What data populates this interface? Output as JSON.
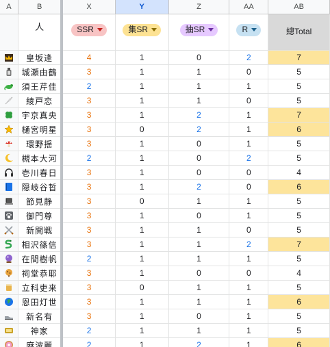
{
  "columns": {
    "a": "A",
    "b": "B",
    "x": "X",
    "y": "Y",
    "z": "Z",
    "aa": "AA",
    "ab": "AB"
  },
  "header": {
    "person_label": "人",
    "ssr": "SSR",
    "ji_sr": "集SR",
    "chou_sr": "抽SR",
    "r": "R",
    "total": "總Total"
  },
  "rows": [
    {
      "icon": "crown-icon",
      "name": "皇坂逢",
      "x": "4",
      "y": "1",
      "z": "0",
      "aa": "2",
      "total": "7",
      "hl": true,
      "xc": "orange",
      "zc": "black",
      "aac": "blue"
    },
    {
      "icon": "bottle-icon",
      "name": "城瀬由鶴",
      "x": "3",
      "y": "1",
      "z": "1",
      "aa": "0",
      "total": "5",
      "hl": false,
      "xc": "orange",
      "zc": "black",
      "aac": "black"
    },
    {
      "icon": "lizard-icon",
      "name": "須王芹佳",
      "x": "2",
      "y": "1",
      "z": "1",
      "aa": "1",
      "total": "5",
      "hl": false,
      "xc": "blue",
      "zc": "black",
      "aac": "black"
    },
    {
      "icon": "feather-icon",
      "name": "綾戸恋",
      "x": "3",
      "y": "1",
      "z": "1",
      "aa": "0",
      "total": "5",
      "hl": false,
      "xc": "orange",
      "zc": "black",
      "aac": "black"
    },
    {
      "icon": "clover-icon",
      "name": "宇京真央",
      "x": "3",
      "y": "1",
      "z": "2",
      "aa": "1",
      "total": "7",
      "hl": true,
      "xc": "orange",
      "zc": "blue",
      "aac": "black"
    },
    {
      "icon": "star-icon",
      "name": "樋宮明星",
      "x": "3",
      "y": "0",
      "z": "2",
      "aa": "1",
      "total": "6",
      "hl": true,
      "xc": "orange",
      "zc": "blue",
      "aac": "black"
    },
    {
      "icon": "mushroom-icon",
      "name": "環野揺",
      "x": "3",
      "y": "1",
      "z": "0",
      "aa": "1",
      "total": "5",
      "hl": false,
      "xc": "orange",
      "zc": "black",
      "aac": "black"
    },
    {
      "icon": "moon-icon",
      "name": "槻本大河",
      "x": "2",
      "y": "1",
      "z": "0",
      "aa": "2",
      "total": "5",
      "hl": false,
      "xc": "blue",
      "zc": "black",
      "aac": "blue"
    },
    {
      "icon": "headphones-icon",
      "name": "壱川春日",
      "x": "3",
      "y": "1",
      "z": "0",
      "aa": "0",
      "total": "4",
      "hl": false,
      "xc": "orange",
      "zc": "black",
      "aac": "black"
    },
    {
      "icon": "book-icon",
      "name": "隠岐谷晢",
      "x": "3",
      "y": "1",
      "z": "2",
      "aa": "0",
      "total": "6",
      "hl": true,
      "xc": "orange",
      "zc": "blue",
      "aac": "black"
    },
    {
      "icon": "laptop-icon",
      "name": "節見静",
      "x": "3",
      "y": "0",
      "z": "1",
      "aa": "1",
      "total": "5",
      "hl": false,
      "xc": "orange",
      "zc": "black",
      "aac": "black"
    },
    {
      "icon": "pawprint-icon",
      "name": "御門尊",
      "x": "3",
      "y": "1",
      "z": "0",
      "aa": "1",
      "total": "5",
      "hl": false,
      "xc": "orange",
      "zc": "black",
      "aac": "black"
    },
    {
      "icon": "swords-icon",
      "name": "新開戦",
      "x": "3",
      "y": "1",
      "z": "1",
      "aa": "0",
      "total": "5",
      "hl": false,
      "xc": "orange",
      "zc": "black",
      "aac": "black"
    },
    {
      "icon": "snake-icon",
      "name": "相沢篠信",
      "x": "3",
      "y": "1",
      "z": "1",
      "aa": "2",
      "total": "7",
      "hl": true,
      "xc": "orange",
      "zc": "black",
      "aac": "blue"
    },
    {
      "icon": "crystal-ball-icon",
      "name": "在間樹帆",
      "x": "2",
      "y": "1",
      "z": "1",
      "aa": "1",
      "total": "5",
      "hl": false,
      "xc": "blue",
      "zc": "black",
      "aac": "black"
    },
    {
      "icon": "cookie-icon",
      "name": "祠堂恭耶",
      "x": "3",
      "y": "1",
      "z": "0",
      "aa": "0",
      "total": "4",
      "hl": false,
      "xc": "orange",
      "zc": "black",
      "aac": "black"
    },
    {
      "icon": "cup-icon",
      "name": "立科吏来",
      "x": "3",
      "y": "0",
      "z": "1",
      "aa": "1",
      "total": "5",
      "hl": false,
      "xc": "orange",
      "zc": "black",
      "aac": "black"
    },
    {
      "icon": "globe-icon",
      "name": "恩田灯世",
      "x": "3",
      "y": "1",
      "z": "1",
      "aa": "1",
      "total": "6",
      "hl": true,
      "xc": "orange",
      "zc": "black",
      "aac": "black"
    },
    {
      "icon": "shoe-icon",
      "name": "新名有",
      "x": "3",
      "y": "1",
      "z": "0",
      "aa": "1",
      "total": "5",
      "hl": false,
      "xc": "orange",
      "zc": "black",
      "aac": "black"
    },
    {
      "icon": "badge-icon",
      "name": "神家",
      "x": "2",
      "y": "1",
      "z": "1",
      "aa": "1",
      "total": "5",
      "hl": false,
      "xc": "blue",
      "zc": "black",
      "aac": "black"
    },
    {
      "icon": "donut-icon",
      "name": "麻波麗",
      "x": "2",
      "y": "1",
      "z": "2",
      "aa": "1",
      "total": "6",
      "hl": true,
      "xc": "blue",
      "zc": "blue",
      "aac": "black"
    }
  ]
}
